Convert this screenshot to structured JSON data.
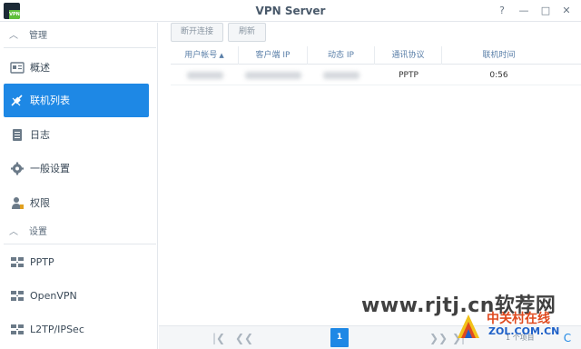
{
  "window": {
    "title": "VPN Server",
    "app_icon_text": "VPN",
    "controls": {
      "help": "?",
      "minimize": "—",
      "maximize": "□",
      "close": "✕"
    }
  },
  "sidebar": {
    "sections": [
      {
        "label": "管理",
        "items": [
          {
            "label": "概述",
            "icon": "overview-icon",
            "active": false
          },
          {
            "label": "联机列表",
            "icon": "connection-list-icon",
            "active": true
          },
          {
            "label": "日志",
            "icon": "log-icon",
            "active": false
          },
          {
            "label": "一般设置",
            "icon": "gear-icon",
            "active": false
          },
          {
            "label": "权限",
            "icon": "user-permission-icon",
            "active": false
          }
        ]
      },
      {
        "label": "设置",
        "items": [
          {
            "label": "PPTP",
            "icon": "network-icon",
            "active": false
          },
          {
            "label": "OpenVPN",
            "icon": "network-icon",
            "active": false
          },
          {
            "label": "L2TP/IPSec",
            "icon": "network-icon",
            "active": false
          }
        ]
      }
    ]
  },
  "toolbar": {
    "disconnect_label": "断开连接",
    "refresh_label": "刷新"
  },
  "table": {
    "columns": [
      "用户帐号",
      "客户端 IP",
      "动态 IP",
      "通讯协议",
      "联机时间"
    ],
    "sort_indicator": "▲",
    "rows": [
      {
        "protocol": "PPTP",
        "uptime": "0:56"
      }
    ]
  },
  "pager": {
    "current_page": "1",
    "count_text": "1 个项目",
    "first": "|❮",
    "prev": "❮❮",
    "next": "❯❯",
    "last": "❯|",
    "refresh": "C"
  },
  "watermark": {
    "site": "www.rjtj.cn软荐网",
    "cn": "中关村在线",
    "domain": "ZOL.COM.CN"
  },
  "colors": {
    "accent": "#1e88e5",
    "sidebar_text": "#3b4a58",
    "header_text": "#5a7fa8"
  }
}
